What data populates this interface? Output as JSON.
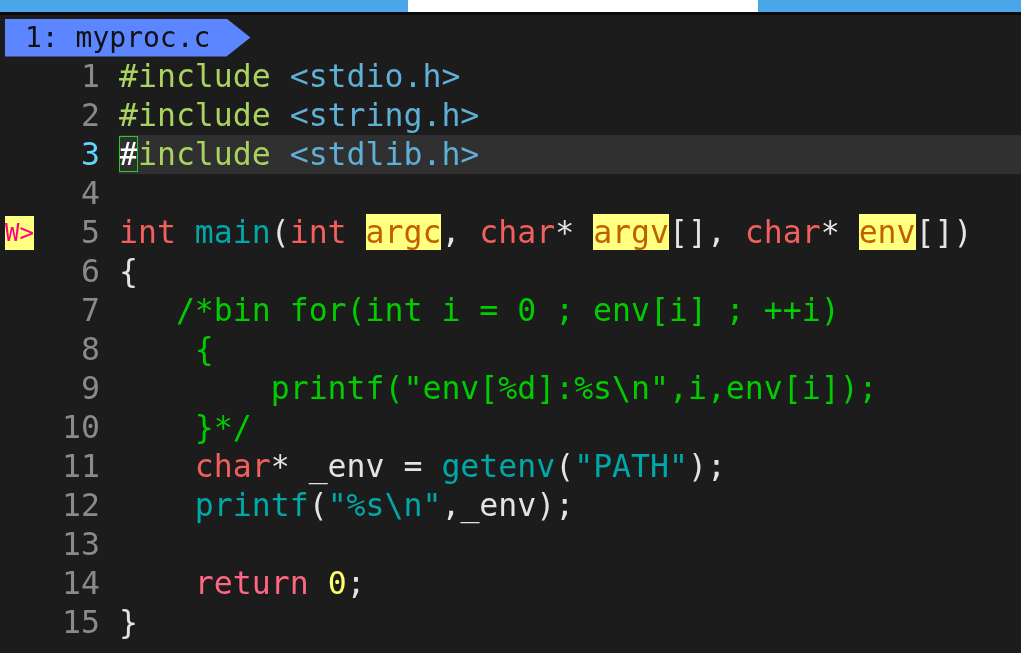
{
  "tab": {
    "label": "1: myproc.c",
    "selected": true
  },
  "lines": [
    {
      "number": "1",
      "current": false,
      "tokens": [
        {
          "kind": "preproc",
          "text": "#include "
        },
        {
          "kind": "path",
          "text": "<stdio.h>"
        }
      ]
    },
    {
      "number": "2",
      "current": false,
      "tokens": [
        {
          "kind": "preproc",
          "text": "#include "
        },
        {
          "kind": "path",
          "text": "<string.h>"
        }
      ]
    },
    {
      "number": "3",
      "current": true,
      "tokens": [
        {
          "kind": "cursor",
          "text": "#"
        },
        {
          "kind": "preproc",
          "text": "include "
        },
        {
          "kind": "path",
          "text": "<stdlib.h>"
        }
      ]
    },
    {
      "number": "4",
      "current": false
    },
    {
      "number": "5",
      "current": false,
      "sign": "W>",
      "tokens": [
        {
          "kind": "type",
          "text": "int "
        },
        {
          "kind": "func",
          "text": "main"
        },
        {
          "kind": "plain",
          "text": "("
        },
        {
          "kind": "type",
          "text": "int "
        },
        {
          "kind": "match",
          "text": "argc"
        },
        {
          "kind": "plain",
          "text": ", "
        },
        {
          "kind": "type",
          "text": "char"
        },
        {
          "kind": "plain",
          "text": "* "
        },
        {
          "kind": "match",
          "text": "argv"
        },
        {
          "kind": "plain",
          "text": "[], "
        },
        {
          "kind": "type",
          "text": "char"
        },
        {
          "kind": "plain",
          "text": "* "
        },
        {
          "kind": "match",
          "text": "env"
        },
        {
          "kind": "plain",
          "text": "[])"
        }
      ]
    },
    {
      "number": "6",
      "current": false,
      "tokens": [
        {
          "kind": "plain",
          "text": "{"
        }
      ]
    },
    {
      "number": "7",
      "current": false,
      "tokens": [
        {
          "kind": "comment",
          "text": "   /*bin for(int i = 0 ; env[i] ; ++i)"
        }
      ]
    },
    {
      "number": "8",
      "current": false,
      "tokens": [
        {
          "kind": "comment",
          "text": "    {"
        }
      ]
    },
    {
      "number": "9",
      "current": false,
      "tokens": [
        {
          "kind": "comment",
          "text": "        printf(\"env[%d]:%s\\n\",i,env[i]);"
        }
      ]
    },
    {
      "number": "10",
      "current": false,
      "tokens": [
        {
          "kind": "comment",
          "text": "    }*/"
        }
      ]
    },
    {
      "number": "11",
      "current": false,
      "tokens": [
        {
          "kind": "type",
          "text": "    char"
        },
        {
          "kind": "plain",
          "text": "* _env = "
        },
        {
          "kind": "func",
          "text": "getenv"
        },
        {
          "kind": "plain",
          "text": "("
        },
        {
          "kind": "string",
          "text": "\"PATH\""
        },
        {
          "kind": "plain",
          "text": ");"
        }
      ]
    },
    {
      "number": "12",
      "current": false,
      "tokens": [
        {
          "kind": "func",
          "text": "    printf"
        },
        {
          "kind": "plain",
          "text": "("
        },
        {
          "kind": "string",
          "text": "\"%s\\n\""
        },
        {
          "kind": "plain",
          "text": ",_env);"
        }
      ]
    },
    {
      "number": "13",
      "current": false
    },
    {
      "number": "14",
      "current": false,
      "tokens": [
        {
          "kind": "keyword",
          "text": "    return "
        },
        {
          "kind": "number",
          "text": "0"
        },
        {
          "kind": "plain",
          "text": ";"
        }
      ]
    },
    {
      "number": "15",
      "current": false,
      "tokens": [
        {
          "kind": "plain",
          "text": "}"
        }
      ]
    }
  ]
}
